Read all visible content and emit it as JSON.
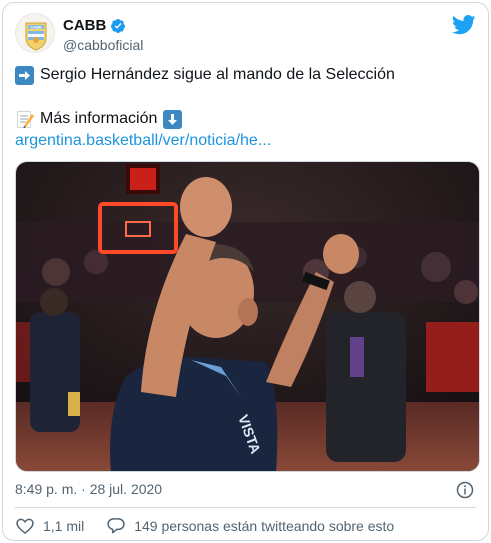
{
  "account": {
    "display_name": "CABB",
    "handle": "@cabboficial",
    "logo_text": "CABB"
  },
  "tweet": {
    "line1": "Sergio Hernández sigue al mando de la Selección",
    "line2": "Más información",
    "link": "argentina.basketball/ver/noticia/he...",
    "timestamp": "8:49 p. m. · 28 jul. 2020"
  },
  "photo": {
    "jersey_text": "VISTA"
  },
  "actions": {
    "like_count": "1,1 mil",
    "conversation_text": "149 personas están twitteando sobre esto"
  },
  "colors": {
    "link": "#1b95e0",
    "verified": "#1d9bf0",
    "twitter_logo": "#1da1f2"
  }
}
